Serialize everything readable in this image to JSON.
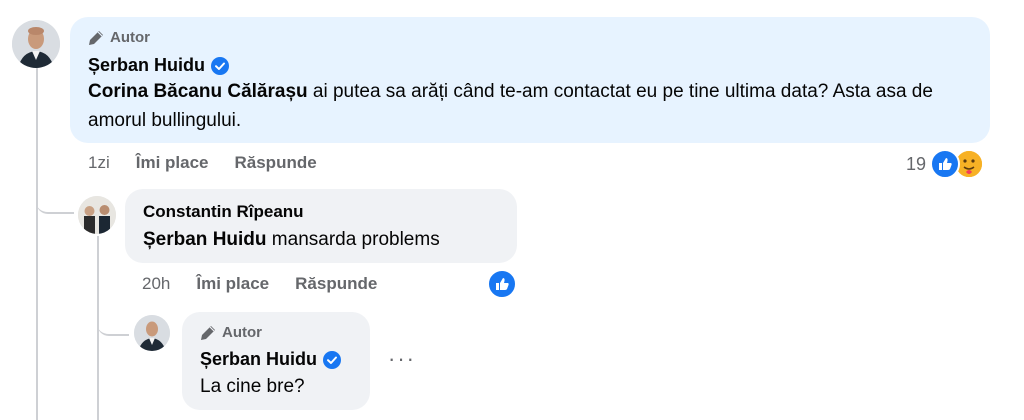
{
  "comment1": {
    "badge": "Autor",
    "author": "Șerban Huidu",
    "mention": "Corina Băcanu Călărașu",
    "text": " ai putea sa arăți când te-am contactat eu pe tine ultima data? Asta asa de amorul bullingului.",
    "time": "1zi",
    "like_label": "Îmi place",
    "reply_label": "Răspunde",
    "reaction_count": "19",
    "reactions": [
      "like-icon",
      "care-icon"
    ]
  },
  "comment2": {
    "author": "Constantin Rîpeanu",
    "mention": "Șerban Huidu",
    "text": " mansarda problems",
    "time": "20h",
    "like_label": "Îmi place",
    "reply_label": "Răspunde",
    "reactions": [
      "like-icon"
    ]
  },
  "comment3": {
    "badge": "Autor",
    "author": "Șerban Huidu",
    "text": "La cine bre?",
    "more": "···"
  },
  "colors": {
    "accent": "#1877f2",
    "author_bubble": "#e7f3ff",
    "reply_bubble": "#f0f2f5",
    "muted_text": "#65676b",
    "thread_line": "#ced0d4"
  }
}
